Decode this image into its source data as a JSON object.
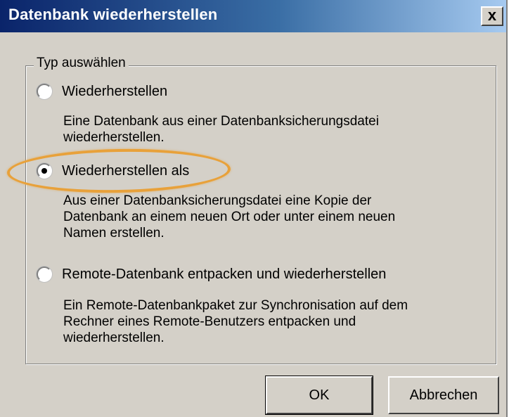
{
  "window": {
    "title": "Datenbank wiederherstellen",
    "close_glyph": "x",
    "close_icon": "close-icon"
  },
  "group": {
    "legend": "Typ auswählen",
    "options": [
      {
        "label": "Wiederherstellen",
        "description_lines": [
          "Eine Datenbank aus einer Datenbanksicherungsdatei",
          "wiederherstellen."
        ],
        "selected": false
      },
      {
        "label": "Wiederherstellen als",
        "description_lines": [
          "Aus einer Datenbanksicherungsdatei eine Kopie der",
          "Datenbank an einem neuen Ort oder unter einem neuen",
          "Namen erstellen."
        ],
        "selected": true
      },
      {
        "label": "Remote-Datenbank entpacken und wiederherstellen",
        "description_lines": [
          "Ein Remote-Datenbankpaket zur Synchronisation auf dem",
          "Rechner eines Remote-Benutzers entpacken und",
          "wiederherstellen."
        ],
        "selected": false
      }
    ]
  },
  "buttons": {
    "ok_label": "OK",
    "cancel_label": "Abbrechen"
  },
  "colors": {
    "title_bar": "#0a246a",
    "dialog_face": "#d4d0c8",
    "highlight": "#e8a13a"
  }
}
